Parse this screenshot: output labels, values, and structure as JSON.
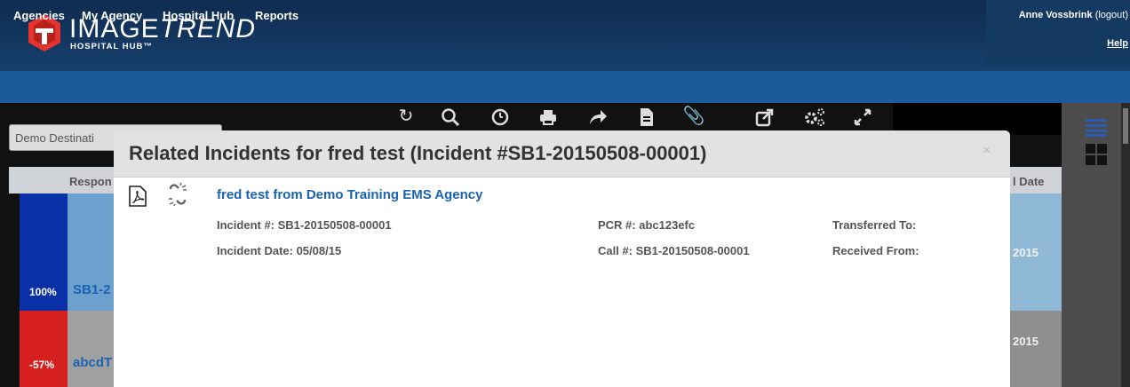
{
  "header": {
    "brand_name_a": "IMAGE",
    "brand_name_b": "TREND",
    "brand_sub": "HOSPITAL HUB™",
    "user_name": "Anne Vossbrink",
    "logout": "(logout)",
    "help": "Help"
  },
  "nav": {
    "items": [
      "Agencies",
      "My Agency",
      "Hospital Hub",
      "Reports"
    ]
  },
  "toolbar": {
    "icons": [
      "refresh-icon",
      "search-icon",
      "clock-icon",
      "print-icon",
      "forward-icon",
      "document-icon",
      "attachment-icon",
      "share-icon",
      "settings-icon",
      "expand-icon"
    ]
  },
  "filter": {
    "value": "Demo Destinati"
  },
  "table": {
    "col_respon": "Respon",
    "col_date": "l Date",
    "rows": [
      {
        "pct": "100%",
        "id": "SB1-2",
        "date": "2015"
      },
      {
        "pct": "-57%",
        "id": "abcdT",
        "date": "2015"
      }
    ]
  },
  "modal": {
    "title": "Related Incidents for fred test (Incident #SB1-20150508-00001)",
    "close": "×",
    "link": "fred test from Demo Training EMS Agency",
    "incident_no": "Incident #: SB1-20150508-00001",
    "incident_date": "Incident Date: 05/08/15",
    "pcr_no": "PCR #: abc123efc",
    "call_no": "Call #: SB1-20150508-00001",
    "transferred_to": "Transferred To:",
    "received_from": "Received From:"
  },
  "colors": {
    "header_dark": "#0e2b4f",
    "nav_blue": "#1c5a9a",
    "link_blue": "#1a63b0",
    "row_blue": "#8fb7d6",
    "pct_blue": "#0a30a8",
    "pct_red": "#d62020"
  }
}
